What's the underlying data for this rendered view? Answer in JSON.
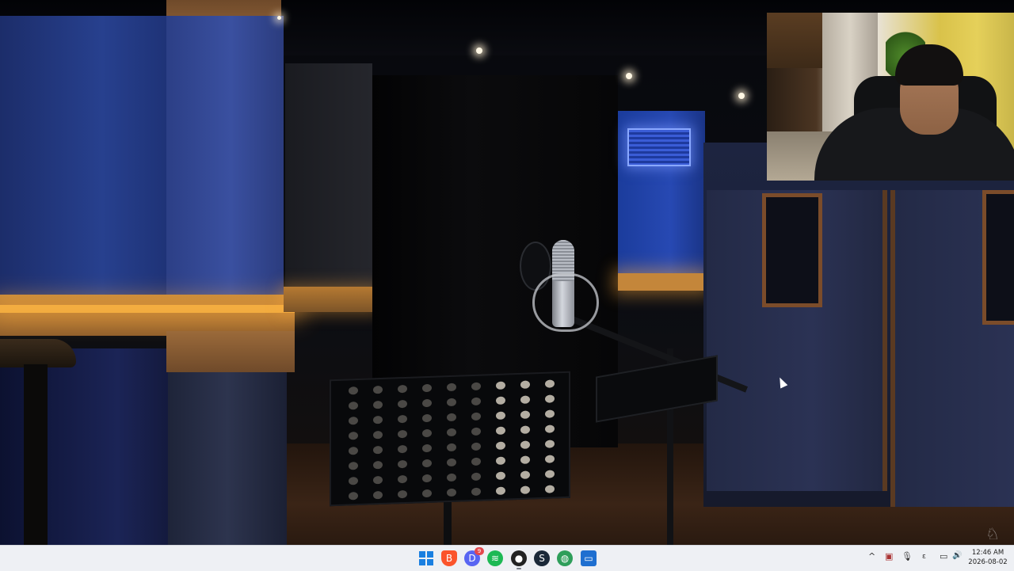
{
  "scene": {
    "description_icon": "studio-video-frame"
  },
  "webcam": {
    "icon": "webcam-overlay"
  },
  "taskbar": {
    "apps": [
      {
        "name": "start",
        "glyph": ""
      },
      {
        "name": "brave",
        "glyph": "B"
      },
      {
        "name": "discord",
        "glyph": "D",
        "badge": "9"
      },
      {
        "name": "spotify",
        "glyph": "≋"
      },
      {
        "name": "obs",
        "glyph": "●"
      },
      {
        "name": "steam",
        "glyph": "S"
      },
      {
        "name": "globe",
        "glyph": "◍"
      },
      {
        "name": "photos",
        "glyph": "▭"
      }
    ],
    "tray": {
      "chevron": "^",
      "lang": "ε",
      "mic": "🎙",
      "network": "▭",
      "volume": "🔊"
    },
    "clock": {
      "time": "12:46 AM",
      "date": "2026-08-02"
    }
  },
  "colors": {
    "accent": "#1a7fe0",
    "taskbar_bg": "#eef0f4"
  }
}
